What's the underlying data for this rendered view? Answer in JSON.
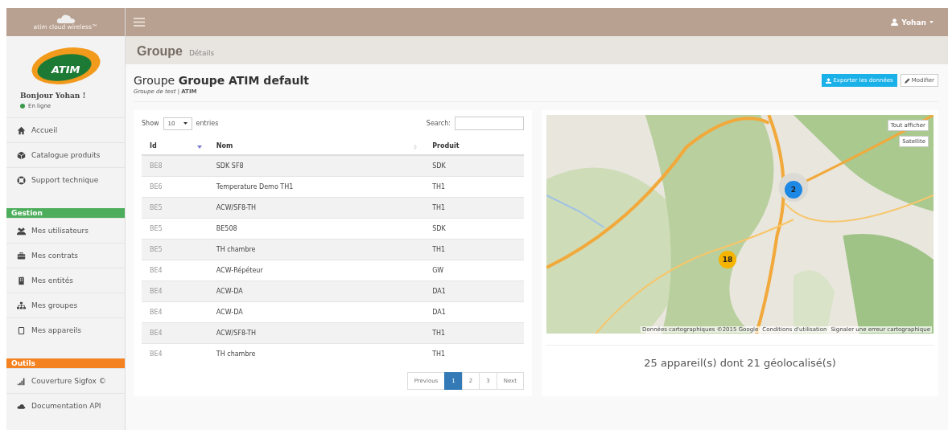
{
  "brand": {
    "tagline": "atim cloud wireless™",
    "logo_text": "ATIM"
  },
  "user": {
    "greeting": "Bonjour Yohan !",
    "status": "En ligne",
    "online": true
  },
  "topbar": {
    "user_name": "Yohan"
  },
  "sidebar": {
    "items": [
      {
        "label": "Accueil"
      },
      {
        "label": "Catalogue produits"
      },
      {
        "label": "Support technique"
      }
    ],
    "sections": [
      {
        "title": "Gestion",
        "color": "#4cae5c",
        "items": [
          {
            "label": "Mes utilisateurs"
          },
          {
            "label": "Mes contrats"
          },
          {
            "label": "Mes entités"
          },
          {
            "label": "Mes groupes"
          },
          {
            "label": "Mes appareils"
          }
        ]
      },
      {
        "title": "Outils",
        "color": "#f58220",
        "items": [
          {
            "label": "Couverture Sigfox ©"
          },
          {
            "label": "Documentation API"
          }
        ]
      }
    ]
  },
  "page_header": {
    "title": "Groupe",
    "subtitle": "Détails"
  },
  "group": {
    "title": "Groupe **Groupe ATIM default**",
    "subtitle": "*Groupe de test* | **ATIM**"
  },
  "actions": [
    {
      "kind": "primary",
      "label": "Exporter les données"
    },
    {
      "kind": "default",
      "label": "Modifier"
    }
  ],
  "table": {
    "length_prefix": "Show",
    "length_value": "10",
    "length_suffix": "entries",
    "search_label": "Search:",
    "columns": [
      {
        "label": "Id"
      },
      {
        "label": "Nom"
      },
      {
        "label": "Produit"
      }
    ],
    "rows": [
      [
        "BE8",
        "SDK SF8",
        "SDK"
      ],
      [
        "BE6",
        "Temperature Demo TH1",
        "TH1"
      ],
      [
        "BE5",
        "ACW/SF8-TH",
        "TH1"
      ],
      [
        "BE5",
        "BE508",
        "SDK"
      ],
      [
        "BE5",
        "TH chambre",
        "TH1"
      ],
      [
        "BE4",
        "ACW-Répéteur",
        "GW"
      ],
      [
        "BE4",
        "ACW-DA",
        "DA1"
      ],
      [
        "BE4",
        "ACW-DA",
        "DA1"
      ],
      [
        "BE4",
        "ACW/SF8-TH",
        "TH1"
      ],
      [
        "BE4",
        "TH chambre",
        "TH1"
      ]
    ],
    "pagination": {
      "previous": "Previous",
      "next": "Next",
      "pages": [
        {
          "label": "1",
          "selected": true
        },
        {
          "label": "2",
          "selected": false
        },
        {
          "label": "3",
          "selected": false
        }
      ]
    }
  },
  "map": {
    "kind": "picture",
    "controls": [
      "Tout afficher",
      "Satellite"
    ],
    "clusters": [
      {
        "count": "2",
        "color": "#1e88e5"
      },
      {
        "count": "18",
        "color": "#f5b400"
      }
    ],
    "attribution": [
      "Données cartographiques ©2015 Google",
      "Conditions d'utilisation",
      "Signaler une erreur cartographique"
    ],
    "summary": "25 appareil(s) dont 21 géolocalisé(s)"
  }
}
